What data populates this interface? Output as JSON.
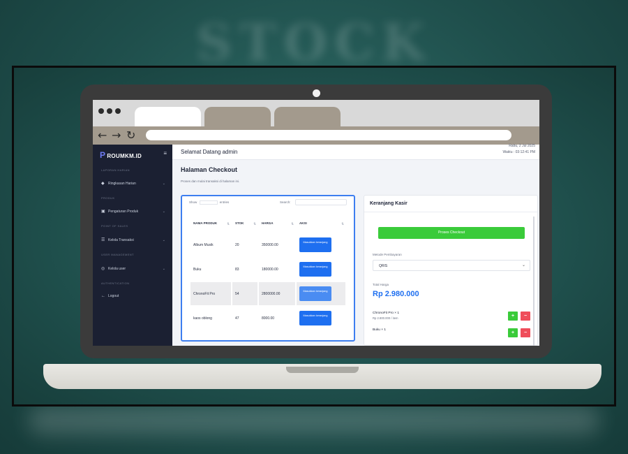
{
  "background_word": "STOCK",
  "sidebar": {
    "logo": "ROUMKM.ID",
    "sections": [
      "LAPORAN HARIAN",
      "PRODUK",
      "POINT OF SALES",
      "USER MANAGEMENT",
      "AUTHENTICATION"
    ],
    "items": [
      {
        "label": "Ringkasan Harian",
        "icon": "tag-icon"
      },
      {
        "label": "Pengaturan Produk",
        "icon": "box-icon"
      },
      {
        "label": "Kelola Transaksi",
        "icon": "list-icon"
      },
      {
        "label": "Kelola user",
        "icon": "eye-icon"
      },
      {
        "label": "Logout",
        "icon": "logout-icon"
      }
    ]
  },
  "topbar": {
    "welcome": "Selamat Datang admin",
    "date": "Rabu, 2 Jul 2025",
    "time": "Waktu : 03:12:41 PM"
  },
  "page": {
    "title": "Halaman Checkout",
    "subtitle": "Proses dan mulai transaksi di halaman ini."
  },
  "table": {
    "show_label": "Show",
    "entries_label": "entries",
    "search_label": "Search:",
    "headers": [
      "NAMA PRODUK",
      "STOK",
      "HARGA",
      "AKSI"
    ],
    "rows": [
      {
        "name": "Album Musik",
        "stok": "20",
        "harga": "350000.00",
        "action": "Masukkan keranjang"
      },
      {
        "name": "Buku",
        "stok": "83",
        "harga": "180000.00",
        "action": "Masukkan keranjang"
      },
      {
        "name": "ChronoFit Pro",
        "stok": "54",
        "harga": "2800000.00",
        "action": "Masukkan keranjang"
      },
      {
        "name": "kaos oblong",
        "stok": "47",
        "harga": "8000.00",
        "action": "Masukkan keranjang"
      }
    ]
  },
  "cart": {
    "title": "Keranjang Kasir",
    "checkout_label": "Proses Checkout",
    "payment_label": "Metode Pembayaran",
    "payment_value": "QRIS",
    "total_label": "Total Harga",
    "total_value": "Rp 2.980.000",
    "items": [
      {
        "name": "ChronoFit Pro × 1",
        "price": "Rp 2.800.000 / item"
      },
      {
        "name": "Buku × 1",
        "price": ""
      }
    ],
    "plus_label": "+",
    "minus_label": "−"
  },
  "colors": {
    "accent": "#1e6ff0",
    "success": "#3acb3a",
    "danger": "#ef4d5a",
    "sidebar": "#1b2032"
  }
}
